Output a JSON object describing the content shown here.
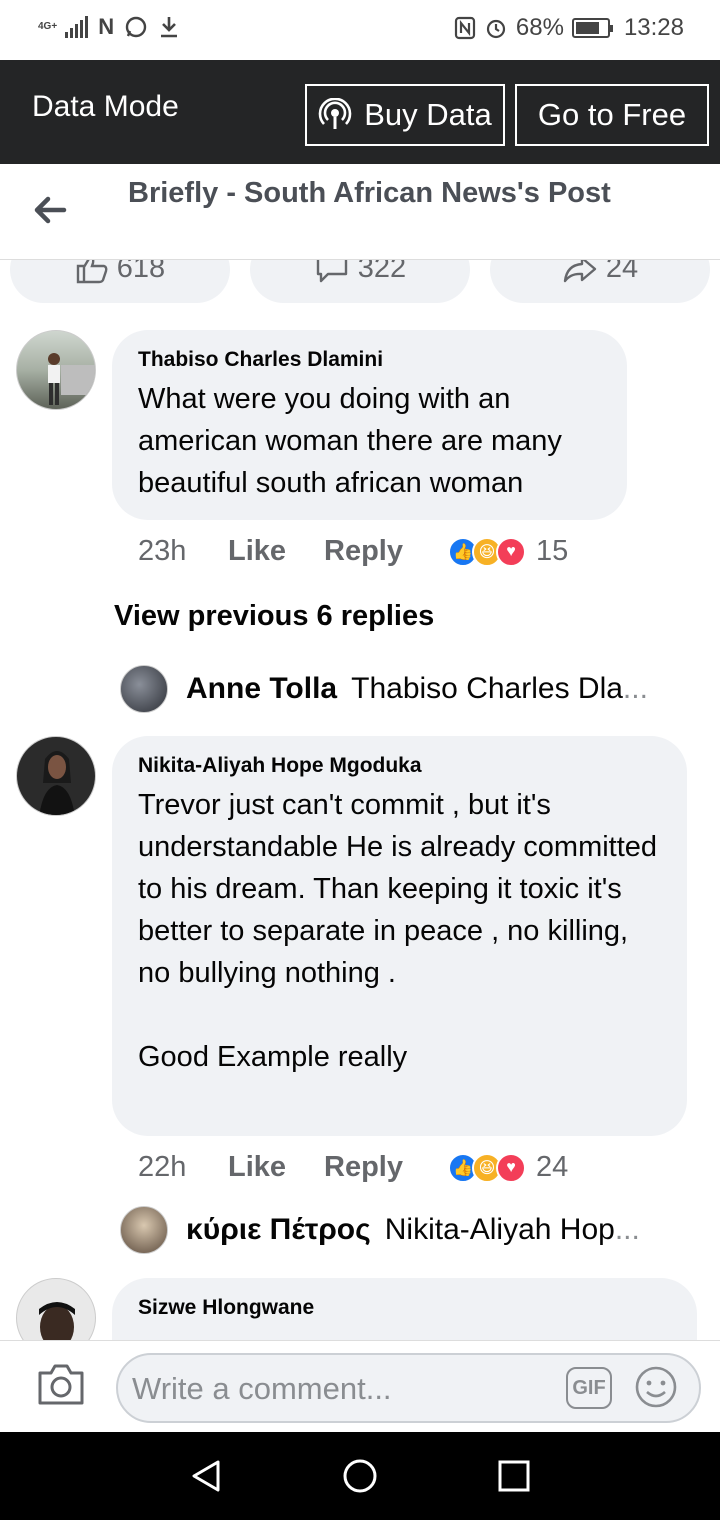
{
  "status_bar": {
    "network": "4G+",
    "battery": "68%",
    "time": "13:28",
    "icons": [
      "signal-icon",
      "n-icon",
      "whatsapp-icon",
      "download-icon",
      "nfc-icon",
      "alarm-icon",
      "battery-icon"
    ]
  },
  "data_bar": {
    "title": "Data Mode",
    "buy_label": "Buy Data",
    "free_label": "Go to Free"
  },
  "header": {
    "title": "Briefly - South African News's Post"
  },
  "stats": {
    "likes": "618",
    "comments": "322",
    "shares": "24"
  },
  "comments": [
    {
      "author": "Thabiso Charles Dlamini",
      "text": "What were you doing with an american woman there are many beautiful south african woman",
      "time": "23h",
      "like_label": "Like",
      "reply_label": "Reply",
      "reactions_count": "15"
    },
    {
      "author": "Nikita-Aliyah Hope Mgoduka",
      "text": "Trevor just can't commit , but it's understandable He is already committed to his dream. Than keeping it toxic it's better to separate in peace , no killing,  no bullying nothing .\n\nGood Example really",
      "time": "22h",
      "like_label": "Like",
      "reply_label": "Reply",
      "reactions_count": "24"
    },
    {
      "author": "Sizwe Hlongwane"
    }
  ],
  "view_previous": "View previous 6 replies",
  "replies": [
    {
      "name": "Anne Tolla",
      "text": "Thabiso Charles Dla",
      "ellipsis": "..."
    },
    {
      "name": "κύριε Πέτρος",
      "text": "Nikita-Aliyah Hop",
      "ellipsis": "..."
    }
  ],
  "composer": {
    "placeholder": "Write a comment...",
    "gif_label": "GIF"
  },
  "colors": {
    "data_bar_bg": "#242526",
    "bubble_bg": "#f0f2f5",
    "like_blue": "#1877f2",
    "haha_yellow": "#f7b125",
    "love_red": "#f33e58"
  }
}
